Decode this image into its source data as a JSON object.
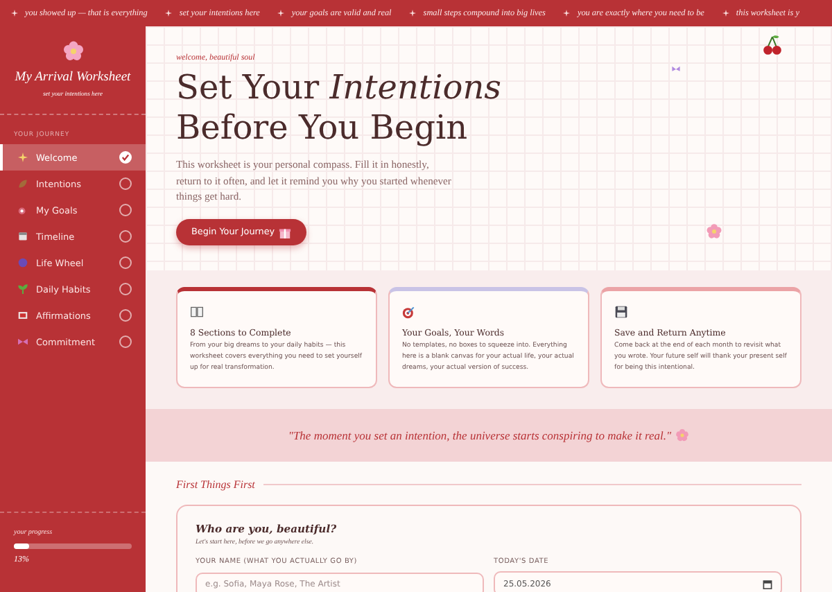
{
  "ticker": [
    "you showed up — that is everything",
    "set your intentions here",
    "your goals are valid and real",
    "small steps compound into big lives",
    "you are exactly where you need to be",
    "this worksheet is y"
  ],
  "sidebar": {
    "title": "My Arrival Worksheet",
    "subtitle": "set your intentions here",
    "section_label": "YOUR JOURNEY",
    "items": [
      {
        "label": "Welcome",
        "selected": true,
        "checked": true
      },
      {
        "label": "Intentions",
        "selected": false,
        "checked": false
      },
      {
        "label": "My Goals",
        "selected": false,
        "checked": false
      },
      {
        "label": "Timeline",
        "selected": false,
        "checked": false
      },
      {
        "label": "Life Wheel",
        "selected": false,
        "checked": false
      },
      {
        "label": "Daily Habits",
        "selected": false,
        "checked": false
      },
      {
        "label": "Affirmations",
        "selected": false,
        "checked": false
      },
      {
        "label": "Commitment",
        "selected": false,
        "checked": false
      }
    ],
    "progress": {
      "label": "your progress",
      "level": 0.13,
      "reading": "13%"
    }
  },
  "hero": {
    "eyebrow": "welcome, beautiful soul",
    "title_line_1": "Set Your *Intentions*",
    "title_line_2": "Before You Begin",
    "text": "This worksheet is your personal compass. Fill it in honestly, return to it often, and let it remind you why you started whenever things get hard.",
    "button": "Begin Your Journey"
  },
  "cards": [
    {
      "title": "8 Sections to Complete",
      "text": "From your big dreams to your daily habits — this worksheet covers everything you need to set yourself up for real transformation.",
      "color": "#b83236"
    },
    {
      "title": "Your Goals, Your Words",
      "text": "No templates, no boxes to squeeze into. Everything here is a blank canvas for your actual life, your actual dreams, your actual version of success.",
      "color": "#c9c3e6"
    },
    {
      "title": "Save and Return Anytime",
      "text": "Come back at the end of each month to revisit what you wrote. Your future self will thank your present self for being this intentional.",
      "color": "#eba3a6"
    }
  ],
  "quote": "\"The moment you set an intention, the universe starts conspiring to make it real.\"",
  "section": {
    "heading": "First Things First",
    "card_title": "Who are you, beautiful?",
    "card_subtitle": "Let's start here, before we go anywhere else.",
    "fields": [
      {
        "label": "YOUR NAME (WHAT YOU ACTUALLY GO BY)",
        "placeholder": "e.g. Sofia, Maya Rose, The Artist"
      },
      {
        "label": "TODAY'S DATE",
        "value": "25.05.2026"
      }
    ]
  }
}
